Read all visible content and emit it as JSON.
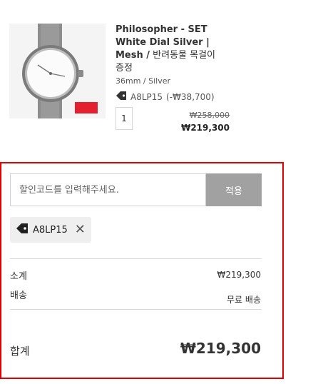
{
  "product": {
    "title_bold": "Philosopher - SET White Dial Silver | Mesh /",
    "title_rest": " 반려동물 목걸이 증정",
    "variant": "36mm / Silver",
    "discount_code": "A8LP15",
    "discount_amount": "(-₩38,700)",
    "quantity": "1",
    "price_original": "₩258,000",
    "price_final": "₩219,300",
    "image_badge": "iF"
  },
  "coupon": {
    "placeholder": "할인코드를 입력해주세요.",
    "apply_label": "적용",
    "applied_code": "A8LP15",
    "remove_symbol": "✕"
  },
  "summary": {
    "subtotal_label": "소계",
    "subtotal_value": "₩219,300",
    "shipping_label": "배송",
    "shipping_value": "무료 배송",
    "total_label": "합계",
    "total_value": "₩219,300"
  },
  "colors": {
    "highlight_border": "#e00000",
    "apply_button": "#a1a1a1"
  }
}
